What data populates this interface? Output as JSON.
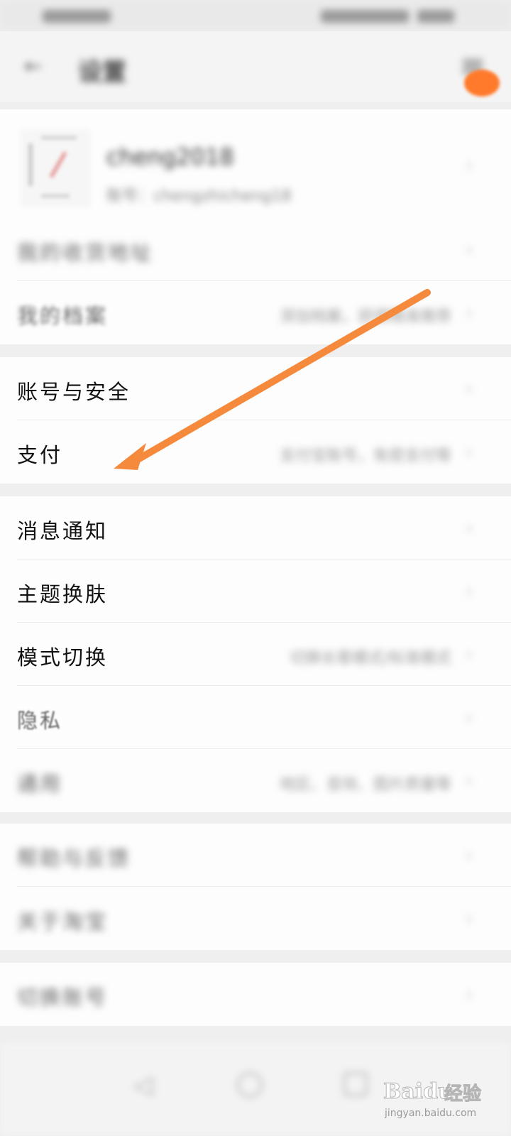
{
  "status_bar": {},
  "header": {
    "back_icon": "back-arrow-icon",
    "title": "设置",
    "menu_icon": "more-icon",
    "accent_color": "#ff7a2a"
  },
  "profile": {
    "name": "cheng2018",
    "account_id": "账号：chengzhicheng18"
  },
  "sections": [
    {
      "rows": [
        {
          "label": "我的收货地址",
          "value": ""
        },
        {
          "label": "我的档案",
          "value": "添加档案，获得精准推荐"
        }
      ]
    },
    {
      "rows": [
        {
          "label": "账号与安全",
          "value": ""
        },
        {
          "label": "支付",
          "value": "支付宝账号，免密支付等"
        }
      ]
    },
    {
      "rows": [
        {
          "label": "消息通知",
          "value": ""
        },
        {
          "label": "主题换肤",
          "value": ""
        },
        {
          "label": "模式切换",
          "value": "切换长辈模式/标准模式"
        },
        {
          "label": "隐私",
          "value": ""
        },
        {
          "label": "通用",
          "value": "地区、音效、图片质量等"
        }
      ]
    },
    {
      "rows": [
        {
          "label": "帮助与反馈",
          "value": ""
        },
        {
          "label": "关于淘宝",
          "value": ""
        }
      ]
    },
    {
      "rows": [
        {
          "label": "切换账号",
          "value": ""
        }
      ]
    }
  ],
  "annotation": {
    "color": "#f58a3c"
  },
  "watermark": {
    "brand": "Baidu",
    "brand_cn": "经验",
    "url": "jingyan.baidu.com"
  }
}
